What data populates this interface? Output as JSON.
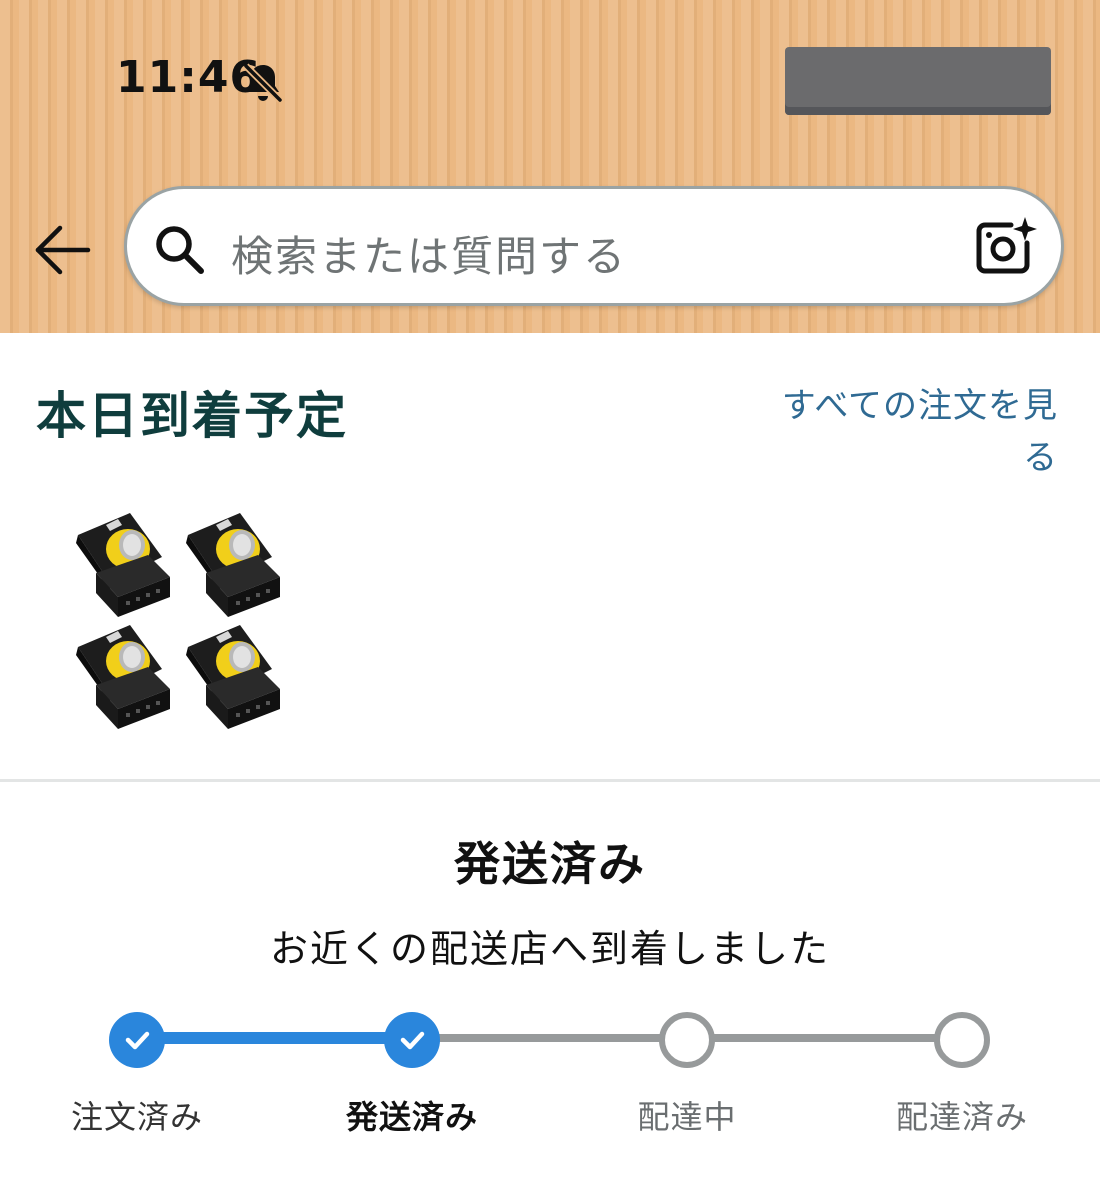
{
  "status_bar": {
    "time": "11:46",
    "bell_icon": "bell-slash-icon"
  },
  "search": {
    "placeholder": "検索または質問する",
    "search_icon": "search-icon",
    "camera_icon": "camera-sparkle-icon",
    "back_icon": "back-arrow-icon"
  },
  "arrivals": {
    "title": "本日到着予定",
    "see_all_line1": "すべての注文を見",
    "see_all_line2": "る"
  },
  "shipment": {
    "status": "発送済み",
    "message": "お近くの配送店へ到着しました",
    "progress_fraction": 0.33,
    "steps": [
      {
        "label": "注文済み",
        "state": "done"
      },
      {
        "label": "発送済み",
        "state": "current"
      },
      {
        "label": "配達中",
        "state": "todo"
      },
      {
        "label": "配達済み",
        "state": "todo"
      }
    ]
  },
  "colors": {
    "header_bg": "#ebb882",
    "title_teal": "#0f3d3d",
    "link_blue": "#2f6a93",
    "progress_blue": "#2a86dc",
    "progress_gray": "#979a9b"
  }
}
